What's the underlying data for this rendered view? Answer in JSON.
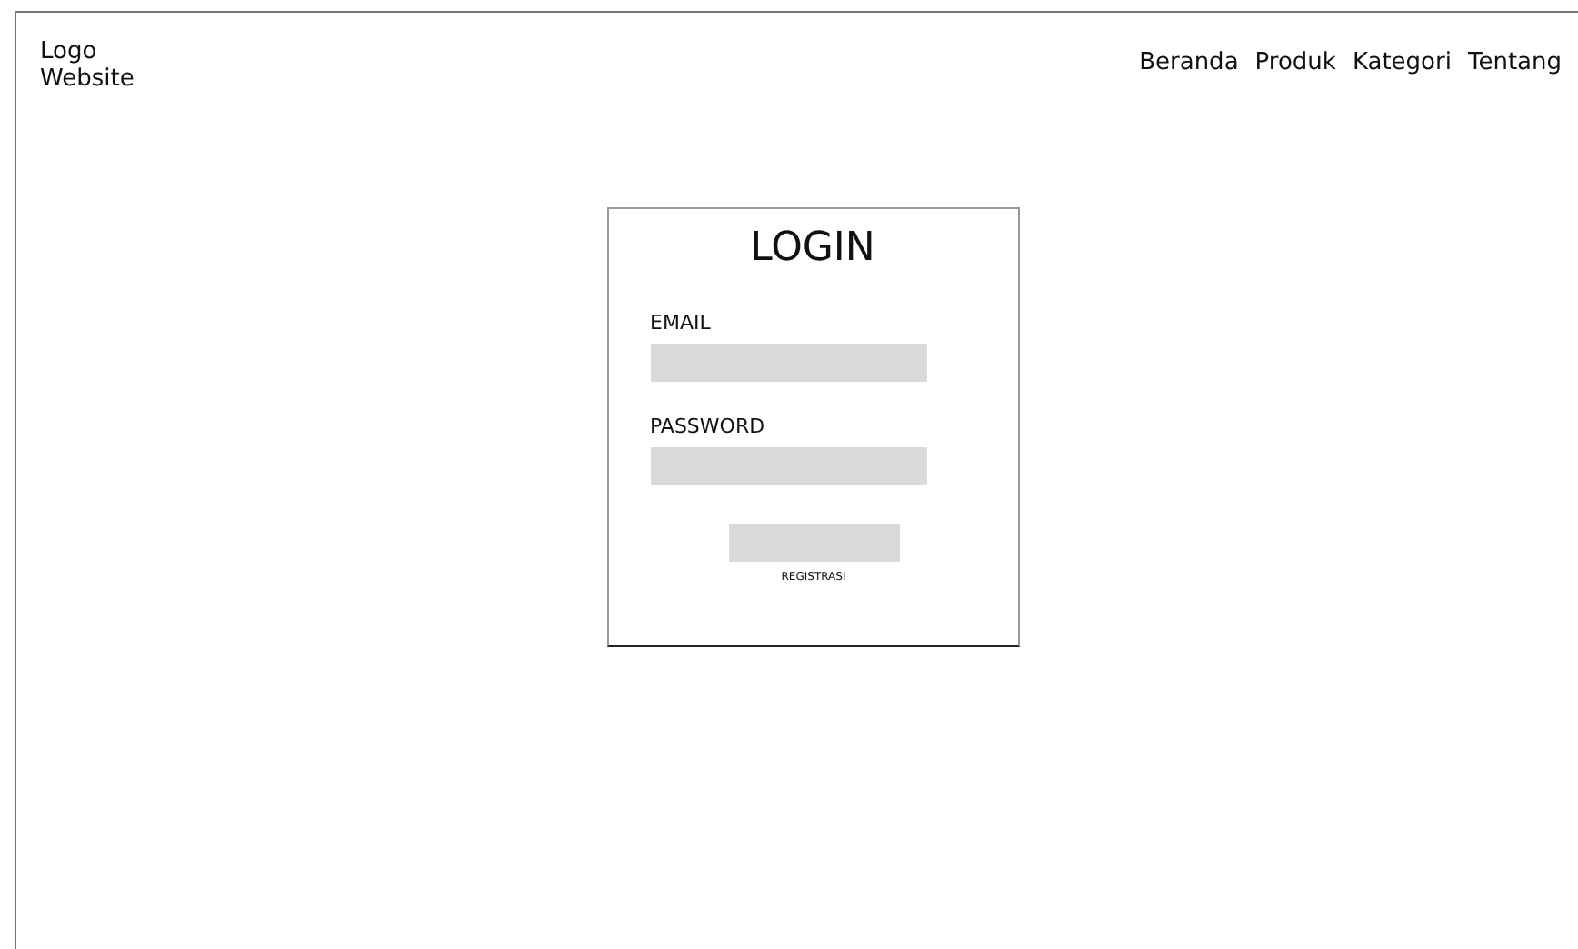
{
  "header": {
    "logo": [
      "Logo",
      "Website"
    ],
    "nav": [
      {
        "label": "Beranda"
      },
      {
        "label": "Produk"
      },
      {
        "label": "Kategori"
      },
      {
        "label": "Tentang"
      }
    ]
  },
  "login_card": {
    "title": "LOGIN",
    "fields": [
      {
        "label": "EMAIL"
      },
      {
        "label": "PASSWORD"
      }
    ],
    "link": "REGISTRASI"
  }
}
